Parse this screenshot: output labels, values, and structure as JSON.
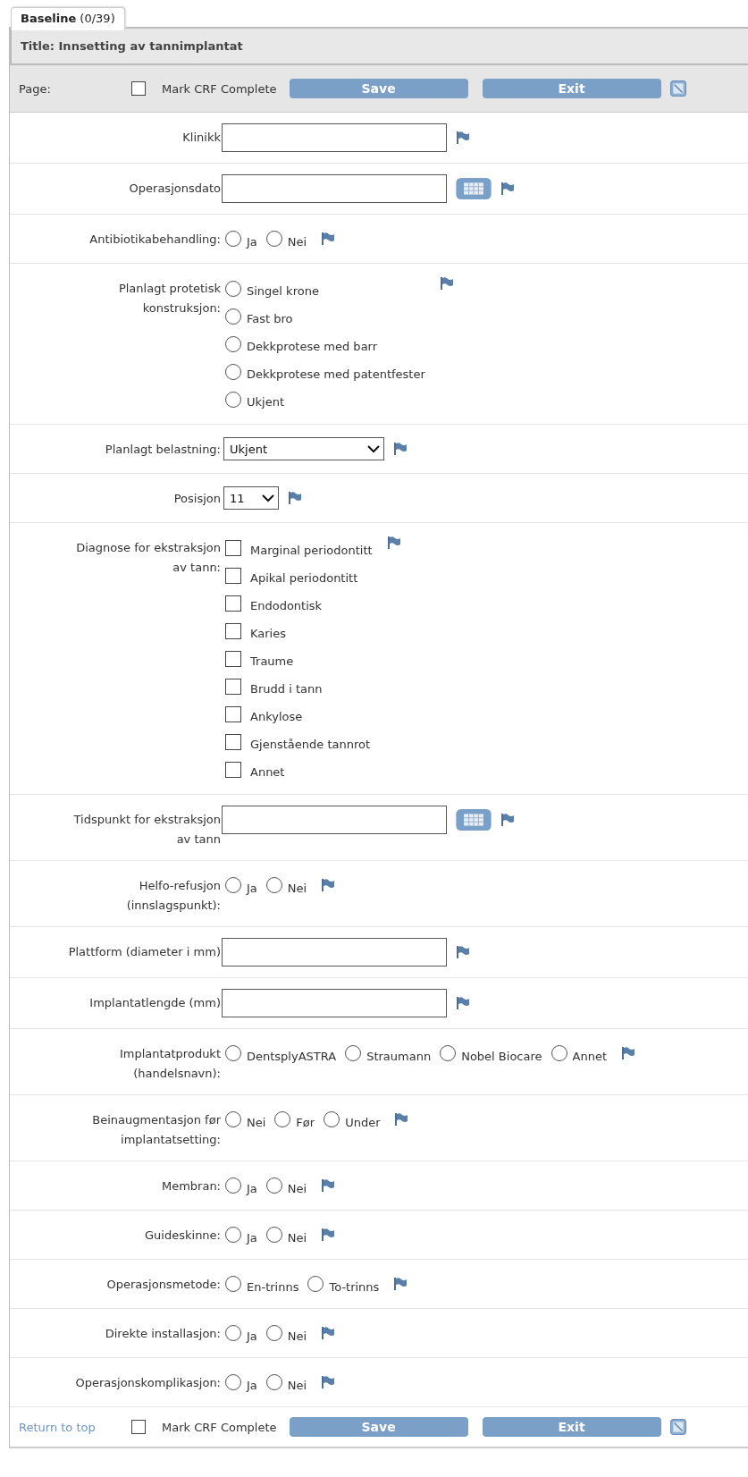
{
  "tab": {
    "label": "Baseline",
    "count": "(0/39)",
    "selected": true
  },
  "title": "Title: Innsetting av tannimplantat",
  "toolbar": {
    "label": "Page:",
    "checked": false,
    "complete_label": "Mark CRF Complete",
    "buttons": [
      "Save",
      "Exit"
    ]
  },
  "fields": [
    {
      "kind": "text",
      "label": "Klinikk"
    },
    {
      "kind": "date",
      "label": "Operasjonsdato"
    },
    {
      "kind": "radio",
      "label": "Antibiotikabehandling:",
      "options": [
        {
          "label": "Ja",
          "selected": false
        },
        {
          "label": "Nei",
          "selected": false
        }
      ]
    },
    {
      "kind": "radio_list",
      "label": "Planlagt protetisk konstruksjon:",
      "options": [
        {
          "label": "Singel krone",
          "selected": false
        },
        {
          "label": "Fast bro",
          "selected": false
        },
        {
          "label": "Dekkprotese med barr",
          "selected": false
        },
        {
          "label": "Dekkprotese med patentfester",
          "selected": false
        },
        {
          "label": "Ukjent",
          "selected": false
        }
      ]
    },
    {
      "kind": "select",
      "label": "Planlagt belastning:",
      "value": "Ukjent",
      "wide": true
    },
    {
      "kind": "select",
      "label": "Posisjon",
      "value": "11",
      "wide": false
    },
    {
      "kind": "checkbox_list",
      "label": "Diagnose for ekstraksjon av tann:",
      "options": [
        {
          "label": "Marginal periodontitt",
          "checked": false
        },
        {
          "label": "Apikal periodontitt",
          "checked": false
        },
        {
          "label": "Endodontisk",
          "checked": false
        },
        {
          "label": "Karies",
          "checked": false
        },
        {
          "label": "Traume",
          "checked": false
        },
        {
          "label": "Brudd i tann",
          "checked": false
        },
        {
          "label": "Ankylose",
          "checked": false
        },
        {
          "label": "Gjenstående tannrot",
          "checked": false
        },
        {
          "label": "Annet",
          "checked": false
        }
      ]
    },
    {
      "kind": "date",
      "label": "Tidspunkt for ekstraksjon av tann"
    },
    {
      "kind": "radio",
      "label": "Helfo-refusjon (innslagspunkt):",
      "options": [
        {
          "label": "Ja",
          "selected": false
        },
        {
          "label": "Nei",
          "selected": false
        }
      ]
    },
    {
      "kind": "text",
      "label": "Plattform (diameter i mm)"
    },
    {
      "kind": "text",
      "label": "Implantatlengde (mm)"
    },
    {
      "kind": "radio",
      "label": "Implantatprodukt (handelsnavn):",
      "options": [
        {
          "label": "DentsplyASTRA",
          "selected": false
        },
        {
          "label": "Straumann",
          "selected": false
        },
        {
          "label": "Nobel Biocare",
          "selected": false
        },
        {
          "label": "Annet",
          "selected": false
        }
      ]
    },
    {
      "kind": "radio",
      "label": "Beinaugmentasjon før implantatsetting:",
      "options": [
        {
          "label": "Nei",
          "selected": false
        },
        {
          "label": "Før",
          "selected": false
        },
        {
          "label": "Under",
          "selected": false
        }
      ]
    },
    {
      "kind": "radio",
      "label": "Membran:",
      "options": [
        {
          "label": "Ja",
          "selected": false
        },
        {
          "label": "Nei",
          "selected": false
        }
      ]
    },
    {
      "kind": "radio",
      "label": "Guideskinne:",
      "options": [
        {
          "label": "Ja",
          "selected": false
        },
        {
          "label": "Nei",
          "selected": false
        }
      ]
    },
    {
      "kind": "radio",
      "label": "Operasjonsmetode:",
      "options": [
        {
          "label": "En-trinns",
          "selected": false
        },
        {
          "label": "To-trinns",
          "selected": false
        }
      ]
    },
    {
      "kind": "radio",
      "label": "Direkte installasjon:",
      "options": [
        {
          "label": "Ja",
          "selected": false
        },
        {
          "label": "Nei",
          "selected": false
        }
      ]
    },
    {
      "kind": "radio",
      "label": "Operasjonskomplikasjon:",
      "options": [
        {
          "label": "Ja",
          "selected": false
        },
        {
          "label": "Nei",
          "selected": false
        }
      ]
    }
  ],
  "footer": {
    "link": "Return to top",
    "checked": false,
    "complete_label": "Mark CRF Complete",
    "buttons": [
      "Save",
      "Exit"
    ]
  }
}
